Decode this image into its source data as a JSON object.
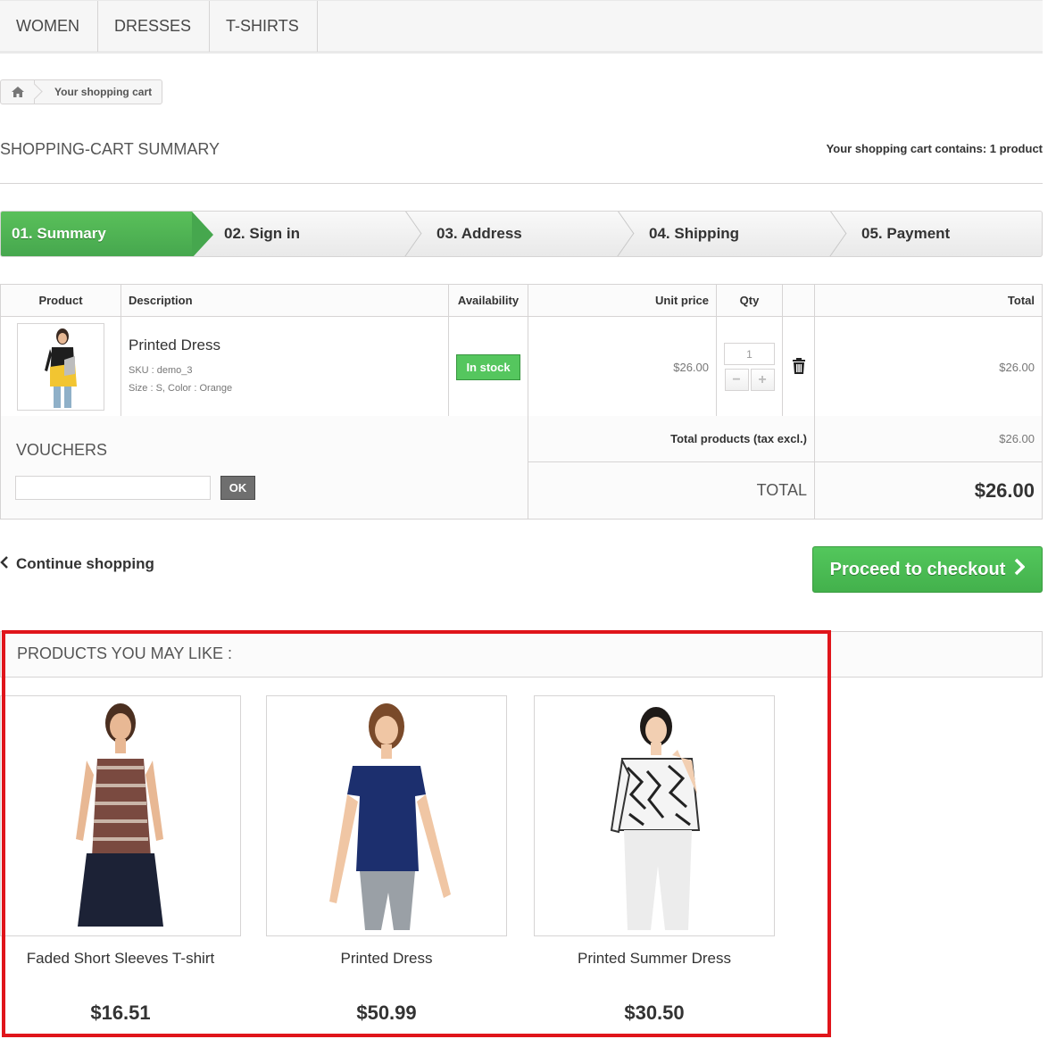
{
  "nav": {
    "items": [
      "WOMEN",
      "DRESSES",
      "T-SHIRTS"
    ]
  },
  "breadcrumb": {
    "home_icon": "home-icon",
    "current": "Your shopping cart"
  },
  "heading": {
    "title": "SHOPPING-CART SUMMARY",
    "contains": "Your shopping cart contains: 1 product"
  },
  "steps": [
    "01. Summary",
    "02. Sign in",
    "03. Address",
    "04. Shipping",
    "05. Payment"
  ],
  "table": {
    "headers": {
      "product": "Product",
      "description": "Description",
      "availability": "Availability",
      "unit_price": "Unit price",
      "qty": "Qty",
      "total": "Total"
    },
    "row": {
      "name": "Printed Dress",
      "sku": "SKU : demo_3",
      "attributes": "Size : S, Color : Orange",
      "availability": "In stock",
      "unit_price": "$26.00",
      "qty": "1",
      "total": "$26.00"
    }
  },
  "vouchers": {
    "title": "VOUCHERS",
    "ok_label": "OK",
    "input_value": ""
  },
  "totals": {
    "products_label": "Total products (tax excl.)",
    "products_value": "$26.00",
    "total_label": "TOTAL",
    "total_value": "$26.00"
  },
  "actions": {
    "continue": "Continue shopping",
    "checkout": "Proceed to checkout"
  },
  "recommendations": {
    "title": "PRODUCTS YOU MAY LIKE :",
    "items": [
      {
        "name": "Faded Short Sleeves T-shirt",
        "price": "$16.51"
      },
      {
        "name": "Printed Dress",
        "price": "$50.99"
      },
      {
        "name": "Printed Summer Dress",
        "price": "$30.50"
      }
    ]
  },
  "colors": {
    "accent_green": "#46a74e",
    "highlight_red": "#e0151b"
  }
}
